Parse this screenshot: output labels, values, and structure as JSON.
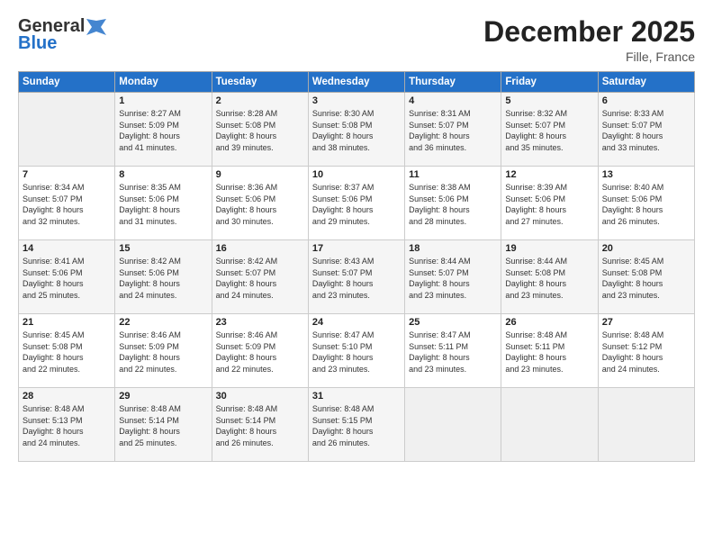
{
  "header": {
    "logo_general": "General",
    "logo_blue": "Blue",
    "month": "December 2025",
    "location": "Fille, France"
  },
  "days_header": [
    "Sunday",
    "Monday",
    "Tuesday",
    "Wednesday",
    "Thursday",
    "Friday",
    "Saturday"
  ],
  "weeks": [
    [
      {
        "num": "",
        "info": ""
      },
      {
        "num": "1",
        "info": "Sunrise: 8:27 AM\nSunset: 5:09 PM\nDaylight: 8 hours\nand 41 minutes."
      },
      {
        "num": "2",
        "info": "Sunrise: 8:28 AM\nSunset: 5:08 PM\nDaylight: 8 hours\nand 39 minutes."
      },
      {
        "num": "3",
        "info": "Sunrise: 8:30 AM\nSunset: 5:08 PM\nDaylight: 8 hours\nand 38 minutes."
      },
      {
        "num": "4",
        "info": "Sunrise: 8:31 AM\nSunset: 5:07 PM\nDaylight: 8 hours\nand 36 minutes."
      },
      {
        "num": "5",
        "info": "Sunrise: 8:32 AM\nSunset: 5:07 PM\nDaylight: 8 hours\nand 35 minutes."
      },
      {
        "num": "6",
        "info": "Sunrise: 8:33 AM\nSunset: 5:07 PM\nDaylight: 8 hours\nand 33 minutes."
      }
    ],
    [
      {
        "num": "7",
        "info": "Sunrise: 8:34 AM\nSunset: 5:07 PM\nDaylight: 8 hours\nand 32 minutes."
      },
      {
        "num": "8",
        "info": "Sunrise: 8:35 AM\nSunset: 5:06 PM\nDaylight: 8 hours\nand 31 minutes."
      },
      {
        "num": "9",
        "info": "Sunrise: 8:36 AM\nSunset: 5:06 PM\nDaylight: 8 hours\nand 30 minutes."
      },
      {
        "num": "10",
        "info": "Sunrise: 8:37 AM\nSunset: 5:06 PM\nDaylight: 8 hours\nand 29 minutes."
      },
      {
        "num": "11",
        "info": "Sunrise: 8:38 AM\nSunset: 5:06 PM\nDaylight: 8 hours\nand 28 minutes."
      },
      {
        "num": "12",
        "info": "Sunrise: 8:39 AM\nSunset: 5:06 PM\nDaylight: 8 hours\nand 27 minutes."
      },
      {
        "num": "13",
        "info": "Sunrise: 8:40 AM\nSunset: 5:06 PM\nDaylight: 8 hours\nand 26 minutes."
      }
    ],
    [
      {
        "num": "14",
        "info": "Sunrise: 8:41 AM\nSunset: 5:06 PM\nDaylight: 8 hours\nand 25 minutes."
      },
      {
        "num": "15",
        "info": "Sunrise: 8:42 AM\nSunset: 5:06 PM\nDaylight: 8 hours\nand 24 minutes."
      },
      {
        "num": "16",
        "info": "Sunrise: 8:42 AM\nSunset: 5:07 PM\nDaylight: 8 hours\nand 24 minutes."
      },
      {
        "num": "17",
        "info": "Sunrise: 8:43 AM\nSunset: 5:07 PM\nDaylight: 8 hours\nand 23 minutes."
      },
      {
        "num": "18",
        "info": "Sunrise: 8:44 AM\nSunset: 5:07 PM\nDaylight: 8 hours\nand 23 minutes."
      },
      {
        "num": "19",
        "info": "Sunrise: 8:44 AM\nSunset: 5:08 PM\nDaylight: 8 hours\nand 23 minutes."
      },
      {
        "num": "20",
        "info": "Sunrise: 8:45 AM\nSunset: 5:08 PM\nDaylight: 8 hours\nand 23 minutes."
      }
    ],
    [
      {
        "num": "21",
        "info": "Sunrise: 8:45 AM\nSunset: 5:08 PM\nDaylight: 8 hours\nand 22 minutes."
      },
      {
        "num": "22",
        "info": "Sunrise: 8:46 AM\nSunset: 5:09 PM\nDaylight: 8 hours\nand 22 minutes."
      },
      {
        "num": "23",
        "info": "Sunrise: 8:46 AM\nSunset: 5:09 PM\nDaylight: 8 hours\nand 22 minutes."
      },
      {
        "num": "24",
        "info": "Sunrise: 8:47 AM\nSunset: 5:10 PM\nDaylight: 8 hours\nand 23 minutes."
      },
      {
        "num": "25",
        "info": "Sunrise: 8:47 AM\nSunset: 5:11 PM\nDaylight: 8 hours\nand 23 minutes."
      },
      {
        "num": "26",
        "info": "Sunrise: 8:48 AM\nSunset: 5:11 PM\nDaylight: 8 hours\nand 23 minutes."
      },
      {
        "num": "27",
        "info": "Sunrise: 8:48 AM\nSunset: 5:12 PM\nDaylight: 8 hours\nand 24 minutes."
      }
    ],
    [
      {
        "num": "28",
        "info": "Sunrise: 8:48 AM\nSunset: 5:13 PM\nDaylight: 8 hours\nand 24 minutes."
      },
      {
        "num": "29",
        "info": "Sunrise: 8:48 AM\nSunset: 5:14 PM\nDaylight: 8 hours\nand 25 minutes."
      },
      {
        "num": "30",
        "info": "Sunrise: 8:48 AM\nSunset: 5:14 PM\nDaylight: 8 hours\nand 26 minutes."
      },
      {
        "num": "31",
        "info": "Sunrise: 8:48 AM\nSunset: 5:15 PM\nDaylight: 8 hours\nand 26 minutes."
      },
      {
        "num": "",
        "info": ""
      },
      {
        "num": "",
        "info": ""
      },
      {
        "num": "",
        "info": ""
      }
    ]
  ]
}
